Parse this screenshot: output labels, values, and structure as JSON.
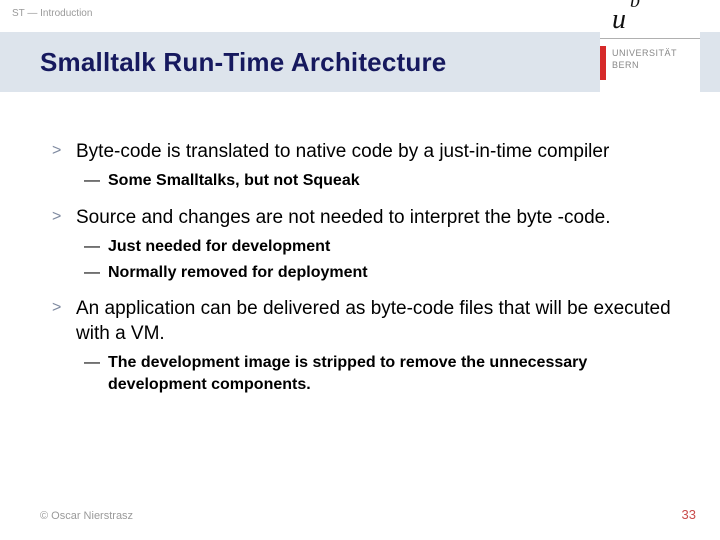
{
  "crumb": "ST — Introduction",
  "title": "Smalltalk Run-Time Architecture",
  "logo": {
    "u": "u",
    "b": "b",
    "uni": "UNIVERSITÄT",
    "bern": "BERN"
  },
  "bullets": {
    "b1": "Byte-code is translated to native code by a just-in-time compiler",
    "b1s1": "Some Smalltalks, but not Squeak",
    "b2": "Source and changes are not needed to interpret the byte -code.",
    "b2s1": "Just needed for development",
    "b2s2": "Normally removed for deployment",
    "b3": "An application can be delivered as byte-code files that will be executed with a VM.",
    "b3s1": "The development image is stripped to remove the unnecessary development components."
  },
  "footer": {
    "left": "© Oscar Nierstrasz",
    "right": "33"
  }
}
